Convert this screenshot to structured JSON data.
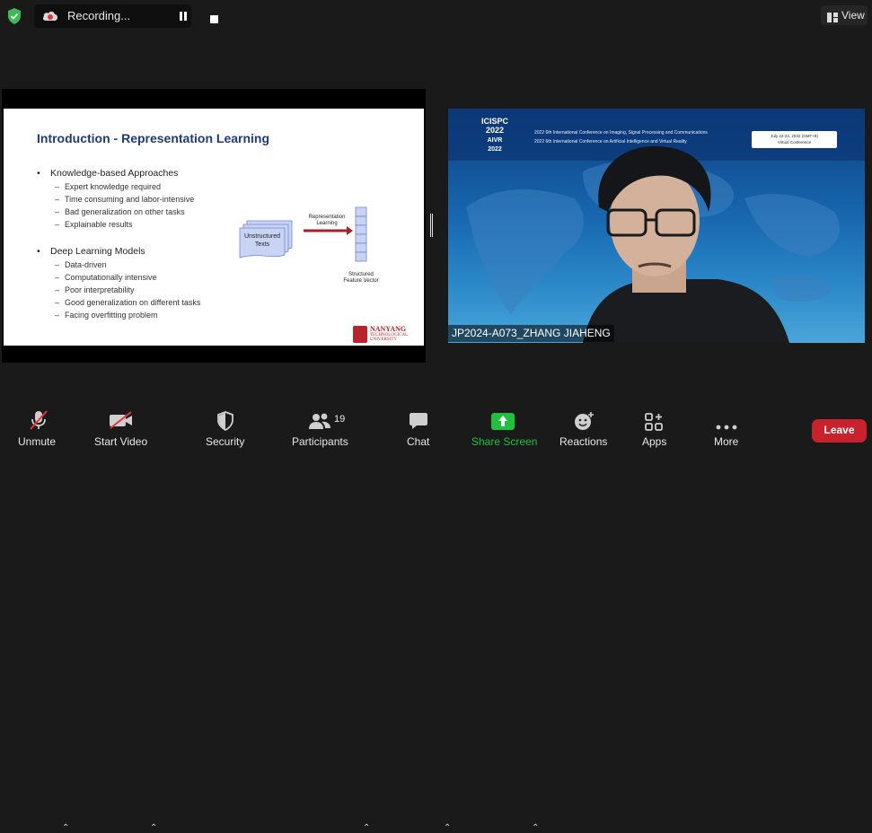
{
  "topbar": {
    "recording_label": "Recording...",
    "view_label": "View",
    "colors": {
      "shield": "#3dba56",
      "rec_pill": "#0f0f0f"
    }
  },
  "slide": {
    "title": "Introduction - Representation Learning",
    "sections": [
      {
        "heading": "Knowledge-based Approaches",
        "items": [
          "Expert knowledge required",
          "Time consuming and labor-intensive",
          "Bad generalization on other tasks",
          "Explainable results"
        ]
      },
      {
        "heading": "Deep Learning Models",
        "items": [
          "Data-driven",
          "Computationally intensive",
          "Poor interpretability",
          "Good generalization on different tasks",
          "Facing overfitting problem"
        ]
      }
    ],
    "diagram": {
      "input_label_1": "Unstructured",
      "input_label_2": "Texts",
      "arrow_label_1": "Representation",
      "arrow_label_2": "Learning",
      "output_label_1": "Structured",
      "output_label_2": "Feature Vector"
    },
    "logo": {
      "name": "NANYANG",
      "sub": "TECHNOLOGICAL UNIVERSITY"
    },
    "colors": {
      "title": "#1f3a7a",
      "arrow": "#a0242a",
      "box": "#c9d4f5"
    }
  },
  "camera": {
    "banner_lines": [
      "2022 6th International Conference on Imaging, Signal Processing and Communications",
      "2022 6th International Conference on Artificial Intelligence and Virtual Reality"
    ],
    "conf_short_1": "ICISPC",
    "conf_year_1": "2022",
    "conf_short_2": "AIVR",
    "conf_year_2": "2022",
    "date_text": "July 22-24, 2022 (GMT+9)",
    "venue_text": "Virtual Conference",
    "participant_name": "JP2024-A073_ZHANG JIAHENG"
  },
  "toolbar": {
    "items": [
      {
        "icon": "microphone-muted-icon",
        "label": "Unmute"
      },
      {
        "icon": "video-off-icon",
        "label": "Start Video"
      },
      {
        "icon": "shield-icon",
        "label": "Security"
      },
      {
        "icon": "participants-icon",
        "label": "Participants",
        "count": "19"
      },
      {
        "icon": "chat-icon",
        "label": "Chat"
      },
      {
        "icon": "share-screen-icon",
        "label": "Share Screen"
      },
      {
        "icon": "reactions-icon",
        "label": "Reactions"
      },
      {
        "icon": "apps-icon",
        "label": "Apps"
      },
      {
        "icon": "more-icon",
        "label": "More"
      }
    ],
    "leave_label": "Leave",
    "colors": {
      "share_screen": "#1fbf3f",
      "leave": "#c8232c"
    }
  }
}
